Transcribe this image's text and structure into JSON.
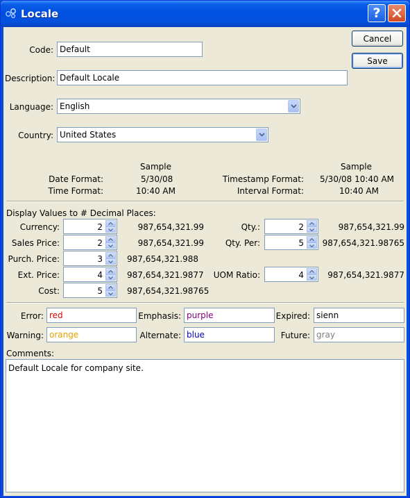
{
  "window": {
    "title": "Locale"
  },
  "buttons": {
    "cancel": "Cancel",
    "save": "Save"
  },
  "form": {
    "code_label": "Code:",
    "code_value": "Default",
    "description_label": "Description:",
    "description_value": "Default Locale",
    "language_label": "Language:",
    "language_value": "English",
    "country_label": "Country:",
    "country_value": "United States"
  },
  "formats": {
    "sample_header_left": "Sample",
    "sample_header_right": "Sample",
    "date_label": "Date Format:",
    "date_sample": "5/30/08",
    "time_label": "Time Format:",
    "time_sample": "10:40 AM",
    "timestamp_label": "Timestamp Format:",
    "timestamp_sample": "5/30/08 10:40 AM",
    "interval_label": "Interval Format:",
    "interval_sample": "10:40 AM"
  },
  "decimals": {
    "section_label": "Display Values to # Decimal Places:",
    "left": [
      {
        "label": "Currency:",
        "value": "2",
        "sample": "987,654,321.99"
      },
      {
        "label": "Sales Price:",
        "value": "2",
        "sample": "987,654,321.99"
      },
      {
        "label": "Purch. Price:",
        "value": "3",
        "sample": "987,654,321.988"
      },
      {
        "label": "Ext. Price:",
        "value": "4",
        "sample": "987,654,321.9877"
      },
      {
        "label": "Cost:",
        "value": "5",
        "sample": "987,654,321.98765"
      }
    ],
    "right": [
      {
        "label": "Qty.:",
        "value": "2",
        "sample": "987,654,321.99"
      },
      {
        "label": "Qty. Per:",
        "value": "5",
        "sample": "987,654,321.98765"
      },
      {
        "label": "UOM Ratio:",
        "value": "4",
        "sample": "987,654,321.9877"
      }
    ]
  },
  "colors": {
    "error_label": "Error:",
    "error_value": "red",
    "error_color": "#e00000",
    "emphasis_label": "Emphasis:",
    "emphasis_value": "purple",
    "emphasis_color": "#800080",
    "expired_label": "Expired:",
    "expired_value": "sienn",
    "expired_color": "#000000",
    "warning_label": "Warning:",
    "warning_value": "orange",
    "warning_color": "#e8a000",
    "alternate_label": "Alternate:",
    "alternate_value": "blue",
    "alternate_color": "#0000c0",
    "future_label": "Future:",
    "future_value": "gray",
    "future_color": "#808080"
  },
  "comments": {
    "label": "Comments:",
    "value": "Default Locale for company site."
  }
}
